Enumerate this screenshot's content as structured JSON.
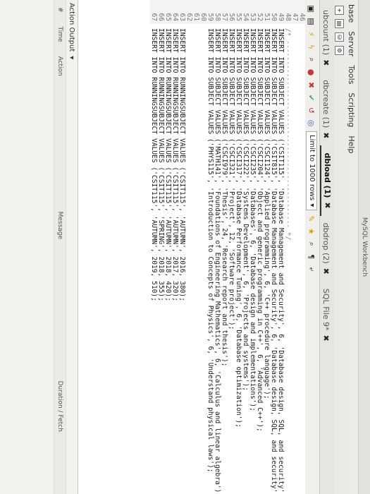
{
  "window": {
    "title": "MySQL Workbench"
  },
  "menu": [
    "base",
    "Server",
    "Tools",
    "Scripting",
    "Help"
  ],
  "tabs": [
    {
      "label": "ubcount (1)",
      "active": false
    },
    {
      "label": "dbcreate (1)",
      "active": false
    },
    {
      "label": "dbload (1)",
      "active": true
    },
    {
      "label": "dbdrop (2)",
      "active": false
    },
    {
      "label": "SQL File 9*",
      "active": false
    }
  ],
  "toolbar": {
    "limit_label": "Limit to 1000 rows"
  },
  "editor": {
    "lines": [
      {
        "n": "46",
        "text": ""
      },
      {
        "n": "47",
        "text": ""
      },
      {
        "n": "48",
        "text": "/* ---------------------------------------------- */"
      },
      {
        "n": "49",
        "text": "INSERT INTO SUBJECT VALUES ('CSIT115', 'Database Management and Security', 6, 'Database design, SQL, and security');"
      },
      {
        "n": "50",
        "text": "INSERT INTO SUBJECT VALUES ('CSIT815', 'Database Management and Security', 6, 'Database design, SQL, and security');"
      },
      {
        "n": "51",
        "text": "INSERT INTO SUBJECT VALUES ('CSCI124', 'Applied programming', 6, 'C++ procedure language');"
      },
      {
        "n": "52",
        "text": "INSERT INTO SUBJECT VALUES ('CSCI204', 'Object and generic programming in C++', 6, 'Advanced C++');"
      },
      {
        "n": "53",
        "text": "INSERT INTO SUBJECT VALUES ('CSCI235', 'Databases', 6, 'Database design and implementations');"
      },
      {
        "n": "54",
        "text": "INSERT INTO SUBJECT VALUES ('CSCI222', 'Systems Development', 6, 'Projects and systems');"
      },
      {
        "n": "55",
        "text": "INSERT INTO SUBJECT VALUES ('CSCI317', 'Database Performance Tuning', 6, 'Database optimization');"
      },
      {
        "n": "56",
        "text": "INSERT INTO SUBJECT VALUES ('CSCI321', 'Project', 12, 'Software project');"
      },
      {
        "n": "57",
        "text": "INSERT INTO SUBJECT VALUES ('CSCI979', 'Thesis', 24, 'Research report and thesis');"
      },
      {
        "n": "58",
        "text": "INSERT INTO SUBJECT VALUES ('MATH141', 'Foundations of Engineering Mathematics', 6, 'Calculus and linear algebra');"
      },
      {
        "n": "59",
        "text": "INSERT INTO SUBJECT VALUES ('PHYS115', 'Introduction to Concepts of Physics', 6, 'Understand physical laws');"
      },
      {
        "n": "60",
        "text": ""
      },
      {
        "n": "61",
        "text": ""
      },
      {
        "n": "62",
        "text": ""
      },
      {
        "n": "63",
        "text": "INSERT INTO RUNNINGSUBJECT VALUES ('CSIT115', 'AUTUMN', 2016, 380);"
      },
      {
        "n": "64",
        "text": "INSERT INTO RUNNINGSUBJECT VALUES ('CSIT115', 'AUTUMN', 2017, 320);"
      },
      {
        "n": "65",
        "text": "INSERT INTO RUNNINGSUBJECT VALUES ('CSIT115', 'AUTUMN', 2018, 420);"
      },
      {
        "n": "66",
        "text": "INSERT INTO RUNNINGSUBJECT VALUES ('CSIT115', 'SPRING', 2018, 355);"
      },
      {
        "n": "67",
        "text": "INSERT INTO RUNNINGSUBJECT VALUES ('CSIT115', 'AUTUMN', 2019, 510);"
      }
    ]
  },
  "output": {
    "header": "Action Output",
    "columns": [
      "#",
      "Time",
      "Action",
      "Message",
      "Duration / Fetch"
    ]
  }
}
